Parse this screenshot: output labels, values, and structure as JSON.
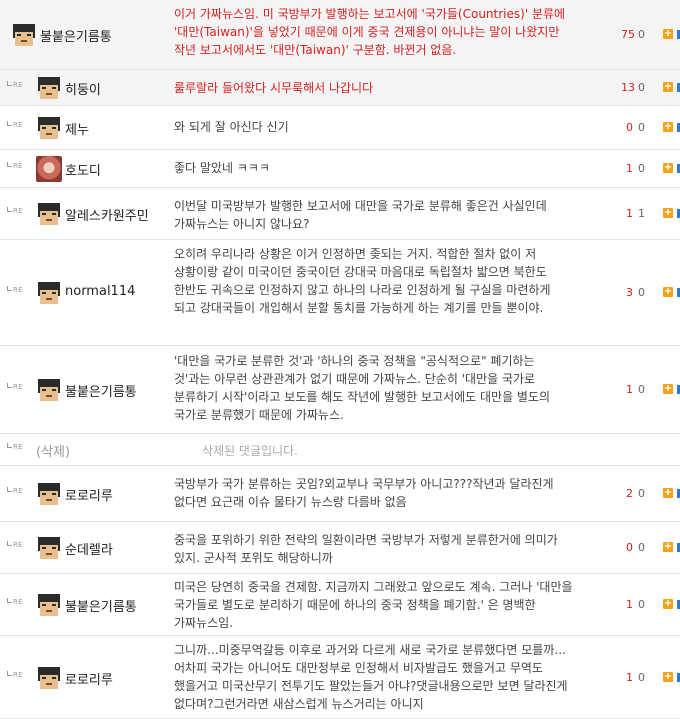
{
  "comments": [
    {
      "reply": false,
      "highlight": true,
      "avatar": "pixel-face",
      "nickname": "불붙은기름통",
      "text": "이거 가짜뉴스임. 미 국방부가 발행하는 보고서에 '국가들(Countries)' 분류에 '대만(Taiwan)'을 넣었기 때문에 이게 중국 견제용이 아니냐는 말이 나왔지만 작년 보고서에서도 '대만(Taiwan)' 구분함. 바뀐거 없음.",
      "text_color": "red",
      "up": "75",
      "down": "0"
    },
    {
      "reply": true,
      "highlight": true,
      "avatar": "pixel-face",
      "nickname": "히둥이",
      "text": "룰루랄라 들어왔다 시무룩해서 나갑니다",
      "text_color": "red",
      "up": "13",
      "down": "0"
    },
    {
      "reply": true,
      "highlight": false,
      "avatar": "pixel-face",
      "nickname": "제누",
      "text": "와 되게 잘 아신다 신기",
      "text_color": "normal",
      "up": "0",
      "down": "0"
    },
    {
      "reply": true,
      "highlight": false,
      "avatar": "photo",
      "nickname": "호도디",
      "text": "좋다 말았네 ㅋㅋㅋ",
      "text_color": "normal",
      "up": "1",
      "down": "0"
    },
    {
      "reply": true,
      "highlight": false,
      "avatar": "pixel-face",
      "nickname": "알레스카원주민",
      "text": "이번달 미국방부가 발행한 보고서에 대만을 국가로 분류해 좋은건 사실인데 가짜뉴스는 아니지 않나요?",
      "text_color": "normal",
      "up": "1",
      "down": "1"
    },
    {
      "reply": true,
      "highlight": false,
      "avatar": "pixel-face",
      "nickname": "normal114",
      "text": "오히려 우리나라 상황은 이거 인정하면 좆되는 거지. 적합한 절차 없이 저 상황이랑 같이 미국이던 중국이던 강대국 마음대로 독립절차 밟으면 북한도 한반도 귀속으로 인정하지 않고 하나의 나라로 인정하게 될 구실을 마련하게 되고 강대국들이 개입해서 분할 통치를 가능하게 하는 계기를 만들 뿐이야.",
      "text_color": "normal",
      "up": "3",
      "down": "0"
    },
    {
      "reply": true,
      "highlight": false,
      "avatar": "pixel-face",
      "nickname": "불붙은기름통",
      "text": "'대만을 국가로 분류한 것'과 '하나의 중국 정책을 \"공식적으로\" 폐기하는 것'과는 아무런 상관관계가 없기 때문에 가짜뉴스. 단순히 '대만을 국가로 분류하기 시작'이라고 보도를 해도 작년에 발행한 보고서에도 대만을 별도의 국가로 분류했기 때문에 가짜뉴스.",
      "text_color": "normal",
      "up": "1",
      "down": "0"
    },
    {
      "reply": true,
      "highlight": false,
      "avatar": "none",
      "nickname": "(삭제)",
      "text": "삭제된 댓글입니다.",
      "text_color": "deleted",
      "up": "",
      "down": ""
    },
    {
      "reply": true,
      "highlight": false,
      "avatar": "pixel-face",
      "nickname": "로로리루",
      "text": "국방부가 국가 분류하는 곳임?외교부나 국무부가 아니고???작년과 달라진게 없다면 요근래 이슈 물타기 뉴스랑 다름바 없음",
      "text_color": "normal",
      "up": "2",
      "down": "0"
    },
    {
      "reply": true,
      "highlight": false,
      "avatar": "pixel-face",
      "nickname": "순데렐라",
      "text": "중국을 포위하기 위한 전략의 일환이라면 국방부가 저렇게 분류한거에 의미가 있지. 군사적 포위도 해당하니까",
      "text_color": "normal",
      "up": "0",
      "down": "0"
    },
    {
      "reply": true,
      "highlight": false,
      "avatar": "pixel-face",
      "nickname": "불붙은기름통",
      "text": "미국은 당연히 중국을 견제함. 지금까지 그래왔고 앞으로도 계속. 그러나 '대만을 국가들로 별도로 분리하기 때문에 하나의 중국 정책을 폐기함.' 은 명백한 가짜뉴스임.",
      "text_color": "normal",
      "up": "1",
      "down": "0"
    },
    {
      "reply": true,
      "highlight": false,
      "avatar": "pixel-face",
      "nickname": "로로리루",
      "text": "그니까...미중무역갈등 이후로 과거와 다르게 새로 국가로 분류했다면 모를까...어차피 국가는 아니어도 대만정부로 인정해서 비자발급도 했을거고 무역도 했을거고 미국산무기 전투기도 팔았는들거 아냐?댓글내용으로만 보면 달라진게 없다며?그런거라면 새삼스럽게 뉴스거리는 아니지",
      "text_color": "normal",
      "up": "1",
      "down": "0"
    }
  ],
  "labels": {
    "reply_marker": "RE",
    "plus_glyph": "+"
  },
  "colors": {
    "highlight_text": "#d6201f",
    "highlight_bg": "#f4f4f4",
    "plus_button": "#f2a31b",
    "edge_bar": "#2b7bd6"
  }
}
